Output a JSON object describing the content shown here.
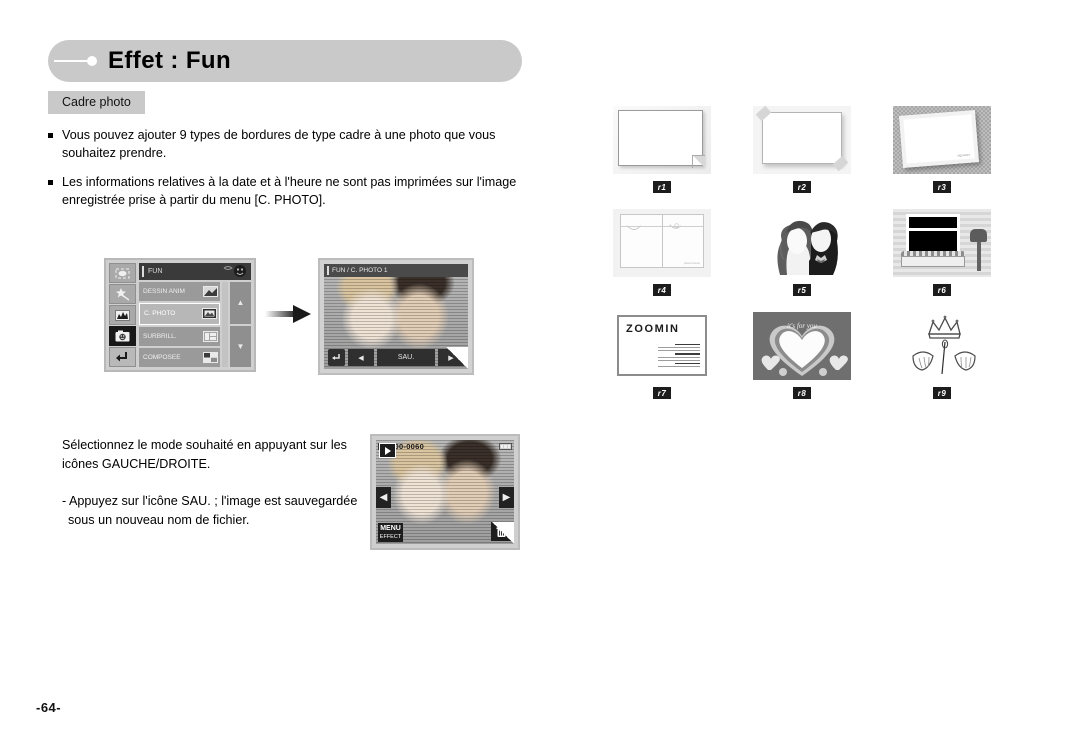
{
  "header": {
    "title": "Effet : Fun",
    "bullet_icon": "line-dot-icon"
  },
  "subtag": {
    "label": "Cadre photo"
  },
  "bullets": [
    "Vous pouvez ajouter 9 types de bordures de type cadre à une photo que vous souhaitez prendre.",
    "Les informations relatives à la date et à l'heure ne sont pas imprimées sur l'image enregistrée prise à partir du menu [C. PHOTO]."
  ],
  "camera_menu": {
    "title": "FUN",
    "side_icons": [
      "frame-icon",
      "magic-wand-icon",
      "image-histogram-icon",
      "smiley-photo-icon",
      "return-arrow-icon"
    ],
    "items": [
      {
        "label": "DESSIN ANIM",
        "icon": "cartoon-icon",
        "selected": false
      },
      {
        "label": "C. PHOTO",
        "icon": "photo-frame-icon",
        "selected": true
      },
      {
        "label": "SURBRILL.",
        "icon": "highlight-icon",
        "selected": false
      },
      {
        "label": "COMPOSEE",
        "icon": "composite-icon",
        "selected": false
      }
    ],
    "scroll_up": "▲",
    "scroll_down": "▼"
  },
  "camera_preview": {
    "title": "FUN / C. PHOTO 1",
    "return_icon": "return-arrow-icon",
    "prev_icon": "◀",
    "save_label": "SAU.",
    "next_icon": "▶"
  },
  "bottom_text": {
    "para1": "Sélectionnez le mode souhaité en appuyant sur les icônes GAUCHE/DROITE.",
    "para2": "- Appuyez sur l'icône SAU. ; l'image est sauvegardée sous un nouveau nom de fichier."
  },
  "camera_playback": {
    "file_number": "100-0060",
    "play_icon": "play-mode-icon",
    "left_arrow": "◀",
    "right_arrow": "▶",
    "menu_label": "MENU",
    "effect_label": "EFFECT",
    "trash_icon": "trash-icon",
    "battery_icon": "battery-icon",
    "film_icon": "memory-card-icon"
  },
  "frames": [
    {
      "tag": "r1",
      "art": "plain-sheet-folded-corner"
    },
    {
      "tag": "r2",
      "art": "taped-white-sheet"
    },
    {
      "tag": "r3",
      "art": "tilted-polaroid-on-texture"
    },
    {
      "tag": "r4",
      "art": "double-page-curtain"
    },
    {
      "tag": "r5",
      "art": "couple-silhouette-cutout"
    },
    {
      "tag": "r6",
      "art": "house-window-mailbox"
    },
    {
      "tag": "r7",
      "art": "zoomin-certificate"
    },
    {
      "tag": "r8",
      "art": "heart-frame"
    },
    {
      "tag": "r9",
      "art": "crown-and-wings"
    }
  ],
  "frame_texts": {
    "zoomin": "ZOOMIN",
    "heart_caption": "it's for you"
  },
  "page_number": "-64-",
  "colors": {
    "header_bg": "#c9c9c9",
    "tag_bg": "#c9c9c9",
    "text": "#000000",
    "frame_tag_bg": "#1c1c1c"
  }
}
